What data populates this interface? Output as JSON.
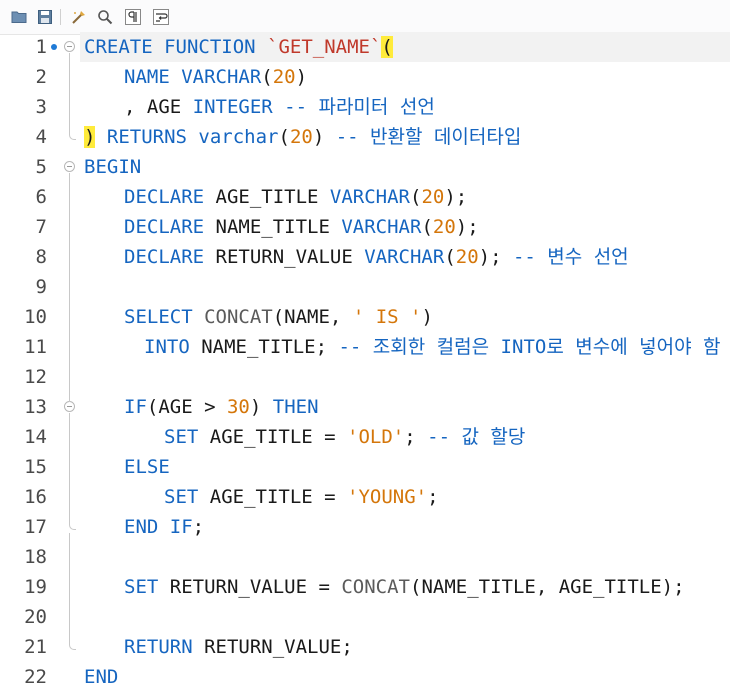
{
  "toolbar": {
    "buttons": [
      {
        "name": "open-folder-icon"
      },
      {
        "name": "save-icon"
      },
      {
        "name": "beautify-icon"
      },
      {
        "name": "find-icon"
      },
      {
        "name": "invisible-chars-icon"
      },
      {
        "name": "word-wrap-icon"
      }
    ]
  },
  "editor": {
    "current_line": 1,
    "lines": [
      {
        "n": "1",
        "tokens": [
          [
            "kw",
            "CREATE FUNCTION "
          ],
          [
            "bq",
            "`GET_NAME`"
          ],
          [
            "bhl",
            "("
          ]
        ]
      },
      {
        "n": "2",
        "tokens": [
          [
            "kw",
            "NAME VARCHAR"
          ],
          [
            "p",
            "("
          ],
          [
            "num",
            "20"
          ],
          [
            "p",
            ")"
          ]
        ]
      },
      {
        "n": "3",
        "tokens": [
          [
            "p",
            ", AGE "
          ],
          [
            "kw",
            "INTEGER"
          ],
          [
            "cm",
            " -- 파라미터 선언"
          ]
        ]
      },
      {
        "n": "4",
        "tokens": [
          [
            "bhl",
            ")"
          ],
          [
            "kw",
            " RETURNS varchar"
          ],
          [
            "p",
            "("
          ],
          [
            "num",
            "20"
          ],
          [
            "p",
            ")"
          ],
          [
            "cm",
            " -- 반환할 데이터타입"
          ]
        ]
      },
      {
        "n": "5",
        "tokens": [
          [
            "kw",
            "BEGIN"
          ]
        ]
      },
      {
        "n": "6",
        "tokens": [
          [
            "kw",
            "DECLARE"
          ],
          [
            "p",
            " AGE_TITLE "
          ],
          [
            "kw",
            "VARCHAR"
          ],
          [
            "p",
            "("
          ],
          [
            "num",
            "20"
          ],
          [
            "p",
            ");"
          ]
        ]
      },
      {
        "n": "7",
        "tokens": [
          [
            "kw",
            "DECLARE"
          ],
          [
            "p",
            " NAME_TITLE "
          ],
          [
            "kw",
            "VARCHAR"
          ],
          [
            "p",
            "("
          ],
          [
            "num",
            "20"
          ],
          [
            "p",
            ");"
          ]
        ]
      },
      {
        "n": "8",
        "tokens": [
          [
            "kw",
            "DECLARE"
          ],
          [
            "p",
            " RETURN_VALUE "
          ],
          [
            "kw",
            "VARCHAR"
          ],
          [
            "p",
            "("
          ],
          [
            "num",
            "20"
          ],
          [
            "p",
            ");"
          ],
          [
            "cm",
            " -- 변수 선언"
          ]
        ]
      },
      {
        "n": "9",
        "tokens": []
      },
      {
        "n": "10",
        "tokens": [
          [
            "kw",
            "SELECT"
          ],
          [
            "p",
            " "
          ],
          [
            "fn",
            "CONCAT"
          ],
          [
            "p",
            "(NAME, "
          ],
          [
            "str",
            "' IS '"
          ],
          [
            "p",
            ")"
          ]
        ]
      },
      {
        "n": "11",
        "tokens": [
          [
            "kw",
            "INTO"
          ],
          [
            "p",
            " NAME_TITLE;"
          ],
          [
            "cm",
            " -- 조회한 컬럼은 INTO로 변수에 넣어야 함"
          ]
        ]
      },
      {
        "n": "12",
        "tokens": []
      },
      {
        "n": "13",
        "tokens": [
          [
            "kw",
            "IF"
          ],
          [
            "p",
            "(AGE > "
          ],
          [
            "num",
            "30"
          ],
          [
            "p",
            ") "
          ],
          [
            "kw",
            "THEN"
          ]
        ]
      },
      {
        "n": "14",
        "tokens": [
          [
            "kw",
            "SET"
          ],
          [
            "p",
            " AGE_TITLE = "
          ],
          [
            "str",
            "'OLD'"
          ],
          [
            "p",
            ";"
          ],
          [
            "cm",
            " -- 값 할당"
          ]
        ]
      },
      {
        "n": "15",
        "tokens": [
          [
            "kw",
            "ELSE"
          ]
        ]
      },
      {
        "n": "16",
        "tokens": [
          [
            "kw",
            "SET"
          ],
          [
            "p",
            " AGE_TITLE = "
          ],
          [
            "str",
            "'YOUNG'"
          ],
          [
            "p",
            ";"
          ]
        ]
      },
      {
        "n": "17",
        "tokens": [
          [
            "kw",
            "END IF"
          ],
          [
            "p",
            ";"
          ]
        ]
      },
      {
        "n": "18",
        "tokens": []
      },
      {
        "n": "19",
        "tokens": [
          [
            "kw",
            "SET"
          ],
          [
            "p",
            " RETURN_VALUE = "
          ],
          [
            "fn",
            "CONCAT"
          ],
          [
            "p",
            "(NAME_TITLE, AGE_TITLE);"
          ]
        ]
      },
      {
        "n": "20",
        "tokens": []
      },
      {
        "n": "21",
        "tokens": [
          [
            "kw",
            "RETURN"
          ],
          [
            "p",
            " RETURN_VALUE;"
          ]
        ]
      },
      {
        "n": "22",
        "tokens": [
          [
            "kw",
            "END"
          ]
        ]
      }
    ]
  }
}
